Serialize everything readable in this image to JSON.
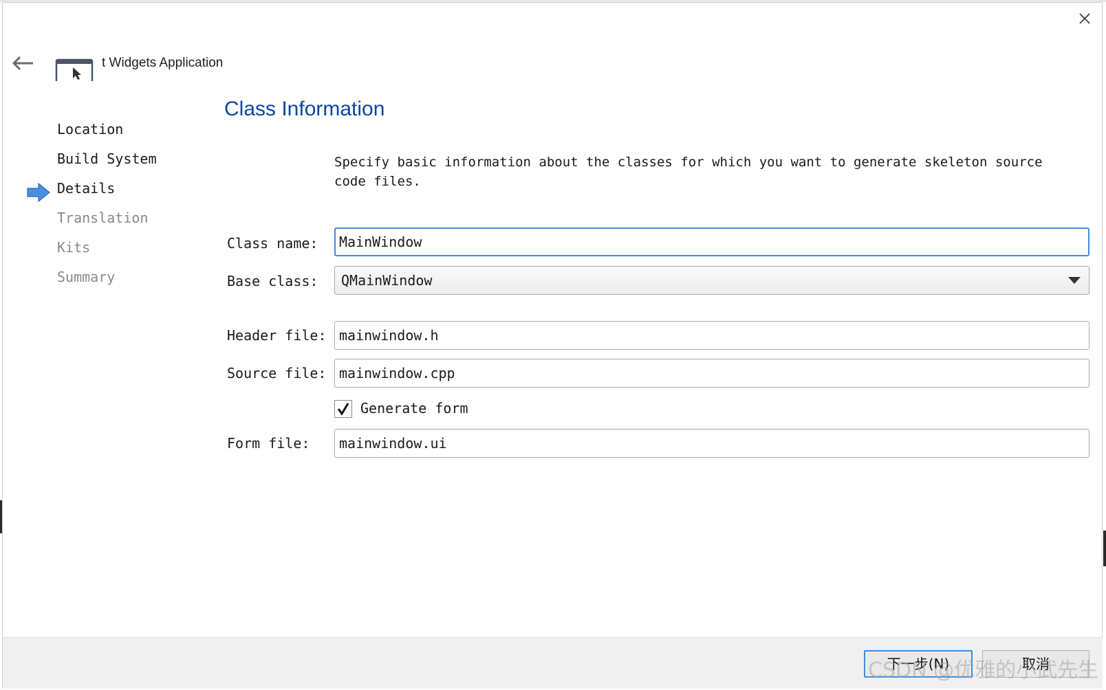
{
  "wizard": {
    "app_title": "t Widgets Application",
    "page_title": "Class Information",
    "description": "Specify basic information about the classes for which you want to generate skeleton source code files.",
    "steps": [
      {
        "label": "Location",
        "state": "done"
      },
      {
        "label": "Build System",
        "state": "done"
      },
      {
        "label": "Details",
        "state": "current"
      },
      {
        "label": "Translation",
        "state": "pending"
      },
      {
        "label": "Kits",
        "state": "pending"
      },
      {
        "label": "Summary",
        "state": "pending"
      }
    ]
  },
  "form": {
    "class_name_label": "Class name:",
    "class_name_value": "MainWindow",
    "base_class_label": "Base class:",
    "base_class_value": "QMainWindow",
    "header_file_label": "Header file:",
    "header_file_value": "mainwindow.h",
    "source_file_label": "Source file:",
    "source_file_value": "mainwindow.cpp",
    "generate_form_label": "Generate form",
    "generate_form_checked": true,
    "form_file_label": "Form file:",
    "form_file_value": "mainwindow.ui"
  },
  "buttons": {
    "next_label": "下一步(N)",
    "cancel_label": "取消"
  },
  "watermark": "CSDN @优雅的小武先生",
  "colors": {
    "title": "#0a46a0",
    "focus": "#3a8fde",
    "step_arrow": "#3a8fde",
    "pending_text": "#8a8a8a"
  },
  "icons": [
    "close-icon",
    "back-arrow-icon",
    "app-window-icon",
    "current-step-arrow-icon",
    "dropdown-arrow-icon",
    "checkmark-icon"
  ]
}
